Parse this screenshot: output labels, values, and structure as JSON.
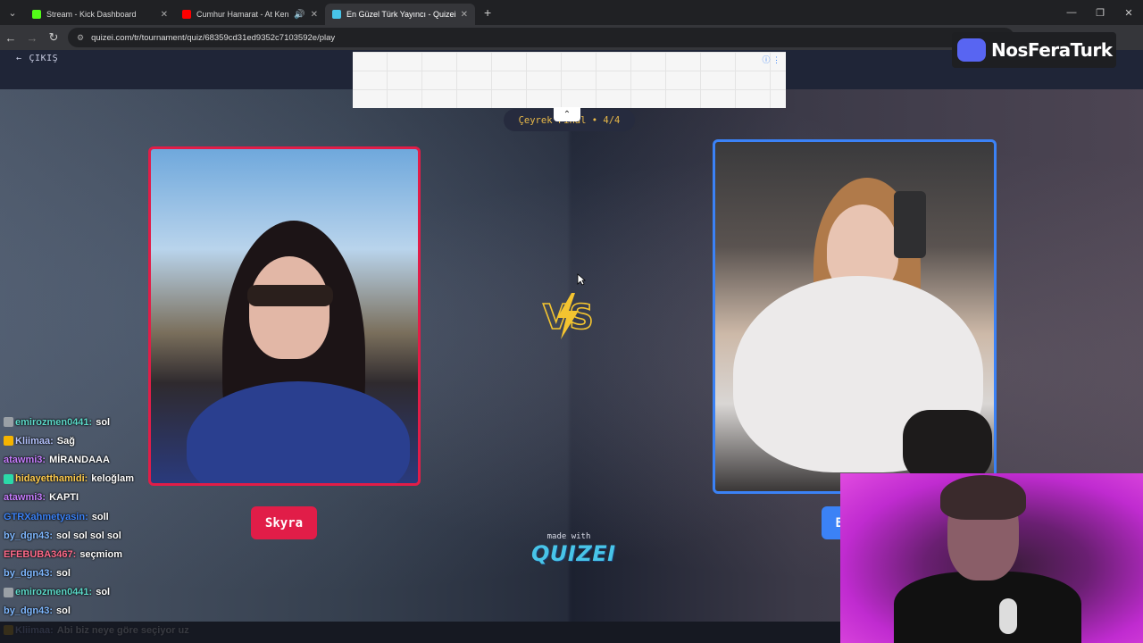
{
  "browser": {
    "tabs": [
      {
        "label": "Stream - Kick Dashboard",
        "color": "#53fc18",
        "active": false
      },
      {
        "label": "Cumhur Hamarat - At Kend",
        "color": "#ff0000",
        "active": false
      },
      {
        "label": "En Güzel Türk Yayıncı - Quizei",
        "color": "#48c4e8",
        "active": true
      }
    ],
    "url": "quizei.com/tr/tournament/quiz/68359cd31ed9352c7103592e/play"
  },
  "page": {
    "exit_label": "ÇIKIŞ",
    "round_label": "Çeyrek Final • 4/4",
    "vs_label": "VS",
    "left_vote_label": "Skyra",
    "right_vote_label": "B",
    "made_with": "made with",
    "brand": "QUIZEI"
  },
  "overlay": {
    "discord_name": "NosFeraTurk"
  },
  "chat": [
    {
      "user": "emirozmen0441:",
      "text": "sol",
      "color": "#5cd9c9",
      "badge": "#9aa0a6"
    },
    {
      "user": "Kliimaa:",
      "text": "Sağ",
      "color": "#b6c4ff",
      "badge": "#f5b400"
    },
    {
      "user": "atawmi3:",
      "text": "MİRANDAAA",
      "color": "#c77dff",
      "badge": ""
    },
    {
      "user": "hidayetthamidi:",
      "text": "keloğlam",
      "color": "#ffcc4d",
      "badge": "#2bd9a8"
    },
    {
      "user": "atawmi3:",
      "text": "KAPTI",
      "color": "#c77dff",
      "badge": ""
    },
    {
      "user": "GTRXahmetyasin:",
      "text": "soll",
      "color": "#3b82f6",
      "badge": ""
    },
    {
      "user": "by_dgn43:",
      "text": "sol sol sol sol",
      "color": "#7fb8ff",
      "badge": ""
    },
    {
      "user": "EFEBUBA3467:",
      "text": "seçmiom",
      "color": "#ff6b8a",
      "badge": ""
    },
    {
      "user": "by_dgn43:",
      "text": "sol",
      "color": "#7fb8ff",
      "badge": ""
    },
    {
      "user": "emirozmen0441:",
      "text": "sol",
      "color": "#5cd9c9",
      "badge": "#9aa0a6"
    },
    {
      "user": "by_dgn43:",
      "text": "sol",
      "color": "#7fb8ff",
      "badge": ""
    },
    {
      "user": "Kliimaa:",
      "text": "Abi biz neye göre seçiyor uz",
      "color": "#b6c4ff",
      "badge": "#f5b400"
    }
  ]
}
